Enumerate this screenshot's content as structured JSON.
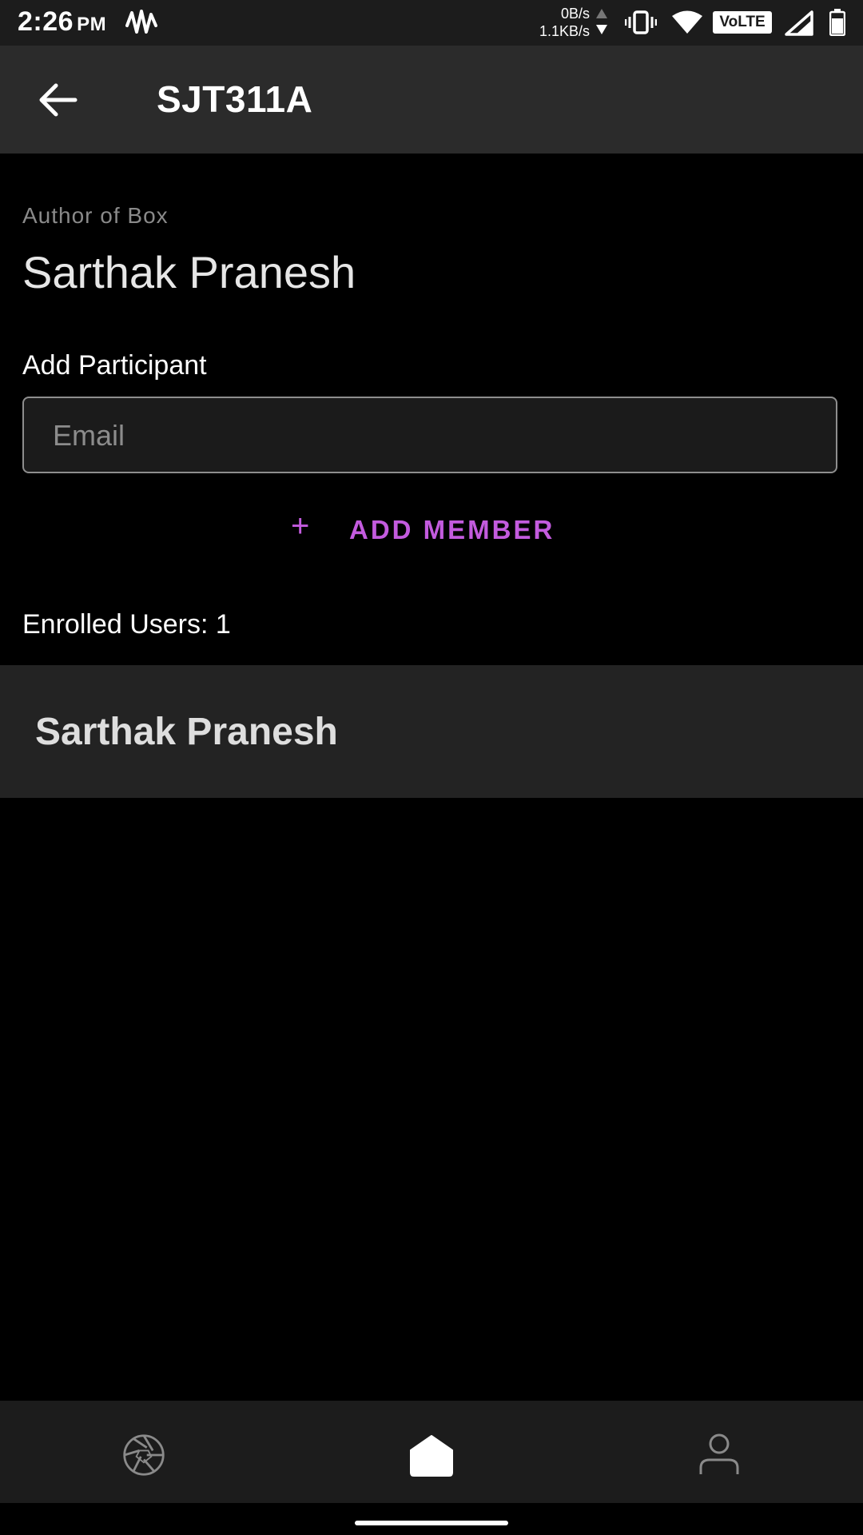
{
  "status_bar": {
    "time": "2:26",
    "ampm": "PM",
    "net_up": "0B/s",
    "net_down": "1.1KB/s",
    "volte": "VoLTE"
  },
  "app_bar": {
    "title": "SJT311A",
    "back_icon": "arrow-back-icon"
  },
  "box": {
    "author_label": "Author of Box",
    "author_name": "Sarthak Pranesh",
    "add_participant_label": "Add Participant",
    "email_placeholder": "Email",
    "email_value": "",
    "add_member_label": "ADD MEMBER",
    "enrolled_label": "Enrolled Users: 1",
    "members": [
      {
        "name": "Sarthak Pranesh"
      }
    ]
  },
  "bottom_nav": {
    "items": [
      {
        "icon": "aperture-icon",
        "active": false
      },
      {
        "icon": "home-icon",
        "active": true
      },
      {
        "icon": "profile-icon",
        "active": false
      }
    ]
  },
  "colors": {
    "accent": "#c35bde",
    "background": "#000000",
    "app_bar": "#2b2b2b",
    "list_row": "#232323"
  }
}
